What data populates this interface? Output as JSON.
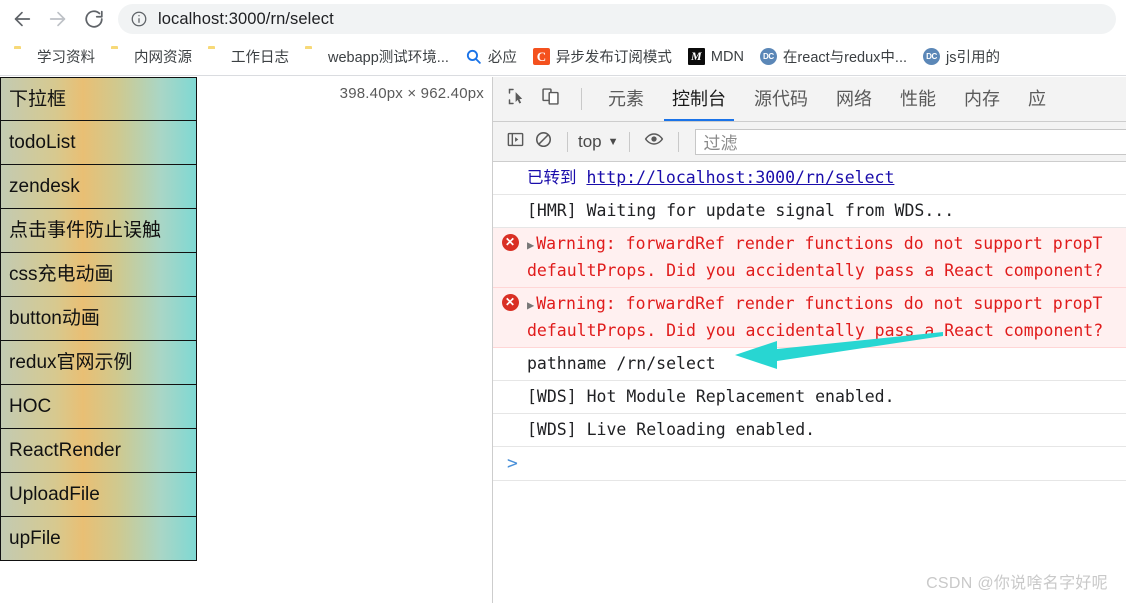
{
  "browser": {
    "back_icon": "arrow-left-icon",
    "forward_icon": "arrow-right-icon",
    "reload_icon": "reload-icon",
    "omnibox": {
      "info_icon": "info-circle-icon",
      "url": "localhost:3000/rn/select"
    },
    "bookmarks": [
      {
        "label": "学习资料",
        "icon": "folder-icon",
        "icon_type": "folder"
      },
      {
        "label": "内网资源",
        "icon": "folder-icon",
        "icon_type": "folder"
      },
      {
        "label": "工作日志",
        "icon": "folder-icon",
        "icon_type": "folder"
      },
      {
        "label": "webapp测试环境...",
        "icon": "folder-icon",
        "icon_type": "folder"
      },
      {
        "label": "必应",
        "icon": "search-icon",
        "icon_type": "search"
      },
      {
        "label": "异步发布订阅模式",
        "icon": "csdn-icon",
        "icon_type": "c",
        "glyph": "C"
      },
      {
        "label": "MDN",
        "icon": "mdn-icon",
        "icon_type": "m",
        "glyph": "M"
      },
      {
        "label": "在react与redux中...",
        "icon": "devcommunity-icon",
        "icon_type": "dc",
        "glyph": "DC"
      },
      {
        "label": "js引用的",
        "icon": "devcommunity-icon",
        "icon_type": "dc",
        "glyph": "DC"
      }
    ]
  },
  "viewport": {
    "size_tip": "398.40px × 962.40px",
    "menu_items": [
      {
        "label": "下拉框"
      },
      {
        "label": "todoList"
      },
      {
        "label": "zendesk"
      },
      {
        "label": "点击事件防止误触"
      },
      {
        "label": "css充电动画"
      },
      {
        "label": "button动画"
      },
      {
        "label": "redux官网示例"
      },
      {
        "label": "HOC"
      },
      {
        "label": "ReactRender"
      },
      {
        "label": "UploadFile"
      },
      {
        "label": "upFile"
      }
    ]
  },
  "devtools": {
    "inspect_icon": "inspect-element-icon",
    "device_icon": "device-toolbar-icon",
    "tabs": [
      {
        "label": "元素",
        "active": false
      },
      {
        "label": "控制台",
        "active": true
      },
      {
        "label": "源代码",
        "active": false
      },
      {
        "label": "网络",
        "active": false
      },
      {
        "label": "性能",
        "active": false
      },
      {
        "label": "内存",
        "active": false
      },
      {
        "label": "应",
        "active": false
      }
    ],
    "active_tab": "控制台",
    "console_toolbar": {
      "sidebar_icon": "console-sidebar-icon",
      "clear_icon": "clear-console-icon",
      "context_label": "top",
      "context_caret": "▼",
      "eye_icon": "live-expression-eye-icon",
      "filter_placeholder": "过滤"
    },
    "console_messages": [
      {
        "type": "navigation",
        "prefix": "已转到",
        "link": "http://localhost:3000/rn/select"
      },
      {
        "type": "log",
        "text": "[HMR] Waiting for update signal from WDS..."
      },
      {
        "type": "error",
        "badge": "✕",
        "expander": "▶",
        "line1": "Warning: forwardRef render functions do not support propT",
        "line2": "defaultProps. Did you accidentally pass a React component?"
      },
      {
        "type": "error",
        "badge": "✕",
        "expander": "▶",
        "line1": "Warning: forwardRef render functions do not support propT",
        "line2": "defaultProps. Did you accidentally pass a React component?"
      },
      {
        "type": "log",
        "text": "pathname /rn/select"
      },
      {
        "type": "log",
        "text": "[WDS] Hot Module Replacement enabled."
      },
      {
        "type": "log",
        "text": "[WDS] Live Reloading enabled."
      }
    ],
    "prompt_caret": ">"
  },
  "annotation": {
    "arrow_icon": "left-arrow-annotation",
    "color": "#28d6d2"
  },
  "watermark": "CSDN @你说啥名字好呢",
  "colors": {
    "accent": "#1a73e8",
    "error": "#e01b1b",
    "error_bg": "#fff0f0",
    "link": "#1a0dab",
    "annotation": "#28d6d2"
  }
}
